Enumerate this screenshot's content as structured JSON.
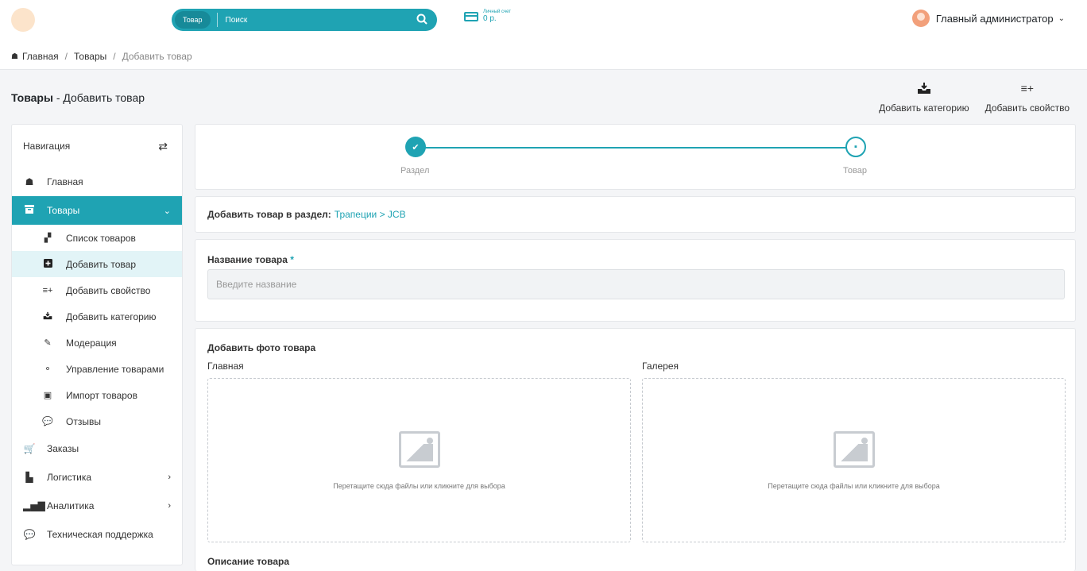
{
  "header": {
    "search": {
      "category": "Товар",
      "placeholder": "Поиск"
    },
    "account": {
      "label": "Личный счет",
      "value": "0 р."
    },
    "user": {
      "name": "Главный администратор"
    }
  },
  "breadcrumb": {
    "home": "Главная",
    "section": "Товары",
    "current": "Добавить товар"
  },
  "page": {
    "title_bold": "Товары",
    "title_rest": " - Добавить товар"
  },
  "actions": {
    "add_category": "Добавить категорию",
    "add_property": "Добавить свойство"
  },
  "sidebar": {
    "title": "Навигация",
    "items": {
      "home": "Главная",
      "products": "Товары",
      "orders": "Заказы",
      "logistics": "Логистика",
      "analytics": "Аналитика",
      "support": "Техническая поддержка"
    },
    "sub": {
      "list": "Список товаров",
      "add": "Добавить товар",
      "add_property": "Добавить свойство",
      "add_category": "Добавить категорию",
      "moderation": "Модерация",
      "manage": "Управление товарами",
      "import": "Импорт товаров",
      "reviews": "Отзывы"
    }
  },
  "stepper": {
    "step1": "Раздел",
    "step2": "Товар"
  },
  "section": {
    "label": "Добавить товар в раздел:",
    "path": "Трапеции > JCB"
  },
  "name_field": {
    "label": "Название товара",
    "required": "*",
    "placeholder": "Введите название"
  },
  "photos": {
    "title": "Добавить фото товара",
    "main": "Главная",
    "gallery": "Галерея",
    "dropzone_text": "Перетащите сюда файлы или кликните для выбора",
    "description_title": "Описание товара"
  },
  "colors": {
    "accent": "#1fa3b3"
  }
}
